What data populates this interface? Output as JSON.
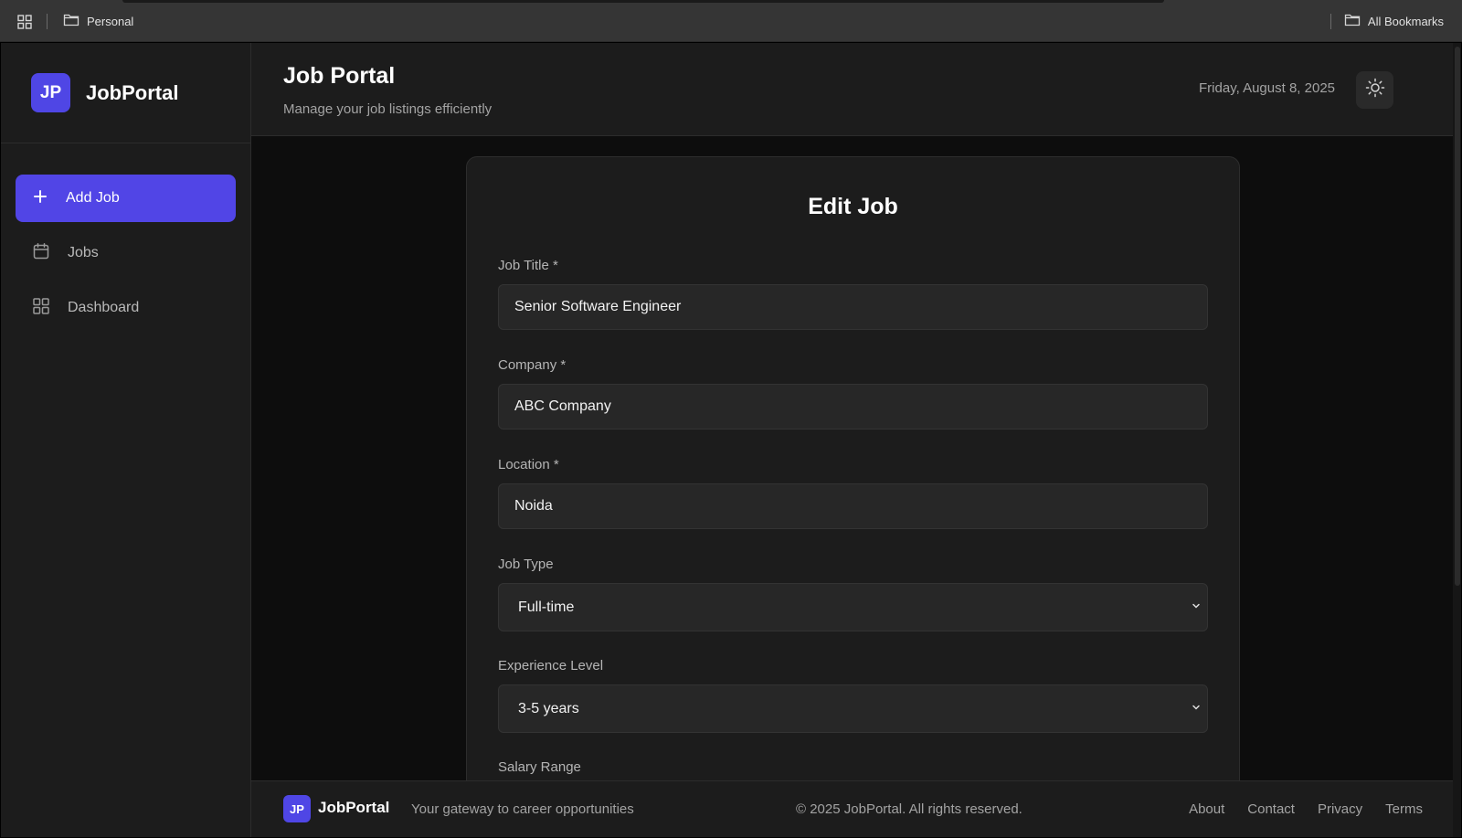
{
  "bookmarks_bar": {
    "apps_icon": "grid-icon",
    "folder_left": "Personal",
    "folder_right": "All Bookmarks"
  },
  "sidebar": {
    "logo_initials": "JP",
    "brand": "JobPortal",
    "items": [
      {
        "label": "Add Job",
        "icon": "plus-icon",
        "active": true
      },
      {
        "label": "Jobs",
        "icon": "calendar-icon",
        "active": false
      },
      {
        "label": "Dashboard",
        "icon": "grid-icon",
        "active": false
      }
    ]
  },
  "header": {
    "title": "Job Portal",
    "subtitle": "Manage your job listings efficiently",
    "date": "Friday, August 8, 2025",
    "theme_icon": "sun-icon"
  },
  "form": {
    "title": "Edit Job",
    "job_title_label": "Job Title *",
    "job_title_value": "Senior Software Engineer",
    "company_label": "Company *",
    "company_value": "ABC Company",
    "location_label": "Location *",
    "location_value": "Noida",
    "job_type_label": "Job Type",
    "job_type_value": "Full-time",
    "experience_label": "Experience Level",
    "experience_value": "3-5 years",
    "salary_label": "Salary Range"
  },
  "footer": {
    "logo_initials": "JP",
    "brand": "JobPortal",
    "tagline": "Your gateway to career opportunities",
    "copyright": "© 2025 JobPortal. All rights reserved.",
    "links": [
      "About",
      "Contact",
      "Privacy",
      "Terms"
    ]
  },
  "colors": {
    "accent": "#5145e6",
    "background": "#0d0d0d",
    "panel": "#1c1c1c"
  }
}
